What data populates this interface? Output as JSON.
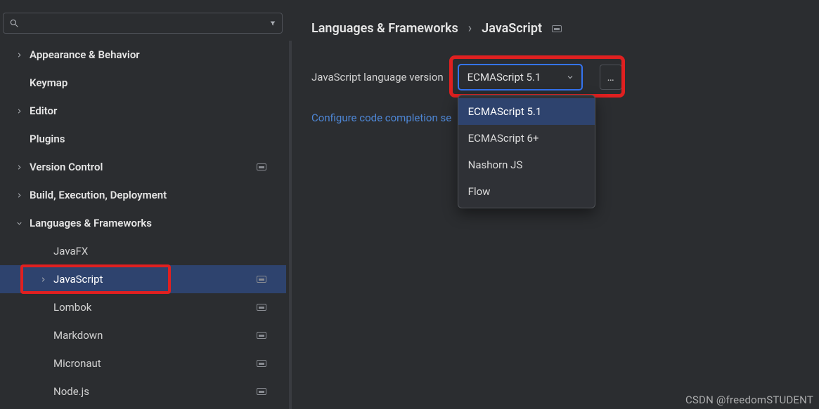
{
  "search": {
    "placeholder": ""
  },
  "sidebar": {
    "items": [
      {
        "label": "Appearance & Behavior",
        "level": 0,
        "expandable": true,
        "expanded": false,
        "badge": false,
        "selected": false
      },
      {
        "label": "Keymap",
        "level": 0,
        "expandable": false,
        "expanded": false,
        "badge": false,
        "selected": false
      },
      {
        "label": "Editor",
        "level": 0,
        "expandable": true,
        "expanded": false,
        "badge": false,
        "selected": false
      },
      {
        "label": "Plugins",
        "level": 0,
        "expandable": false,
        "expanded": false,
        "badge": false,
        "selected": false
      },
      {
        "label": "Version Control",
        "level": 0,
        "expandable": true,
        "expanded": false,
        "badge": true,
        "selected": false
      },
      {
        "label": "Build, Execution, Deployment",
        "level": 0,
        "expandable": true,
        "expanded": false,
        "badge": false,
        "selected": false
      },
      {
        "label": "Languages & Frameworks",
        "level": 0,
        "expandable": true,
        "expanded": true,
        "badge": false,
        "selected": false
      },
      {
        "label": "JavaFX",
        "level": 1,
        "expandable": false,
        "expanded": false,
        "badge": false,
        "selected": false
      },
      {
        "label": "JavaScript",
        "level": 1,
        "expandable": true,
        "expanded": false,
        "badge": true,
        "selected": true
      },
      {
        "label": "Lombok",
        "level": 1,
        "expandable": false,
        "expanded": false,
        "badge": true,
        "selected": false
      },
      {
        "label": "Markdown",
        "level": 1,
        "expandable": false,
        "expanded": false,
        "badge": true,
        "selected": false
      },
      {
        "label": "Micronaut",
        "level": 1,
        "expandable": false,
        "expanded": false,
        "badge": true,
        "selected": false
      },
      {
        "label": "Node.js",
        "level": 1,
        "expandable": false,
        "expanded": false,
        "badge": true,
        "selected": false
      }
    ]
  },
  "breadcrumbs": {
    "parent": "Languages & Frameworks",
    "sep": "›",
    "current": "JavaScript"
  },
  "form": {
    "language_version_label": "JavaScript language version",
    "language_version_value": "ECMAScript 5.1",
    "options": [
      {
        "label": "ECMAScript 5.1",
        "selected": true
      },
      {
        "label": "ECMAScript 6+",
        "selected": false
      },
      {
        "label": "Nashorn JS",
        "selected": false
      },
      {
        "label": "Flow",
        "selected": false
      }
    ],
    "more": "…"
  },
  "link_text": "Configure code completion se",
  "watermark": "CSDN @freedomSTUDENT"
}
